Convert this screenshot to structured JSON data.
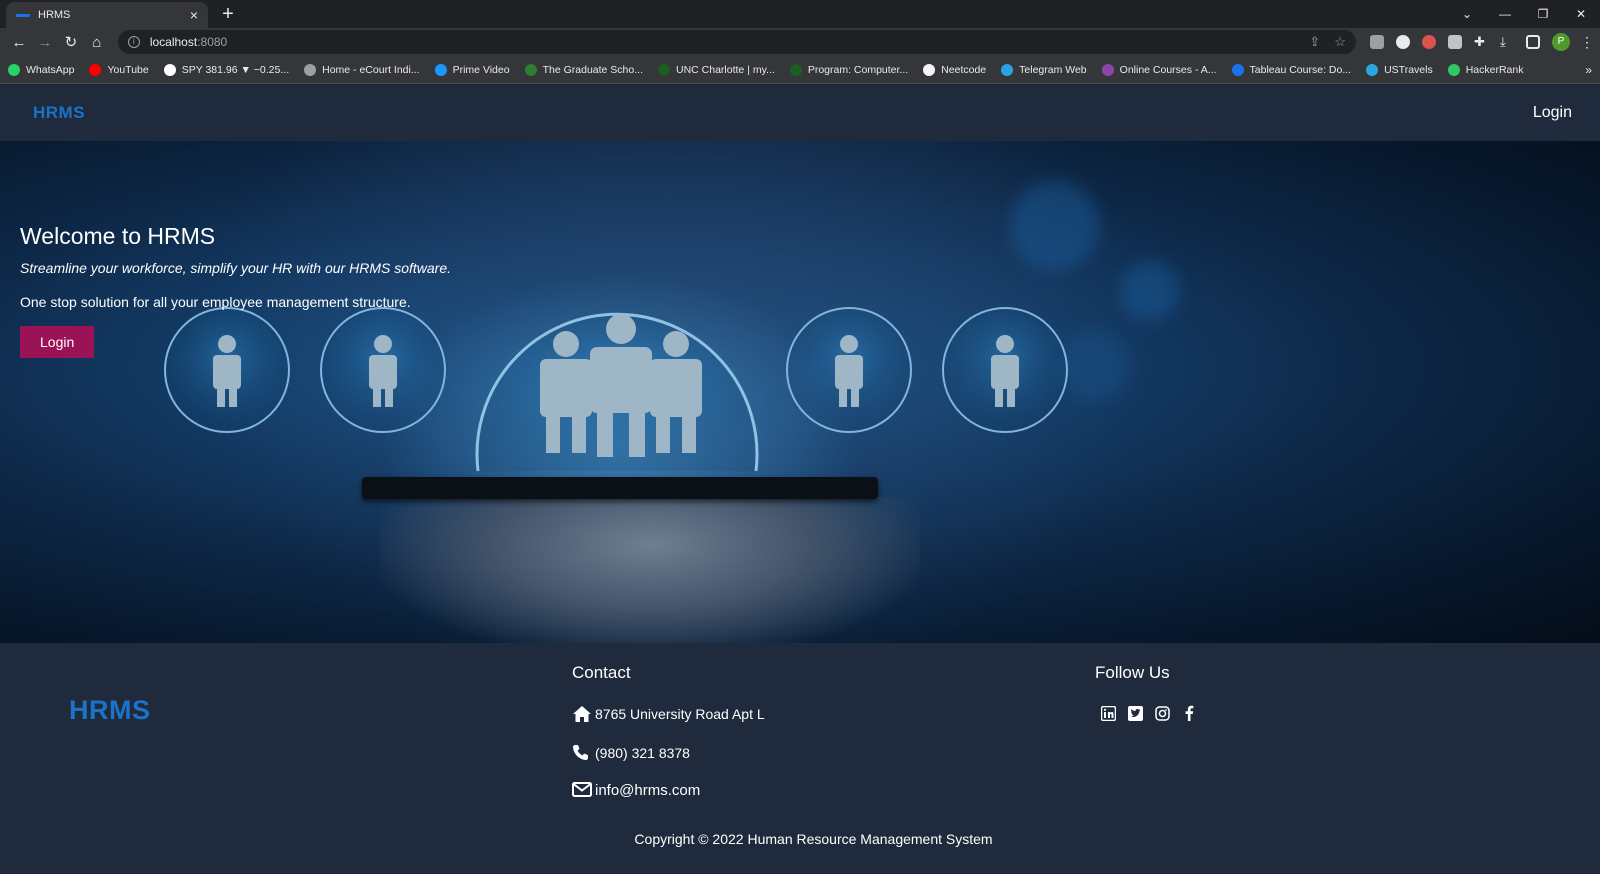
{
  "browser": {
    "tab_title": "HRMS",
    "tab_close": "×",
    "new_tab": "+",
    "url_host": "localhost",
    "url_port": ":8080",
    "bookmarks": [
      {
        "label": "WhatsApp",
        "color": "#25d366"
      },
      {
        "label": "YouTube",
        "color": "#ff0000"
      },
      {
        "label": "SPY 381.96 ▼ −0.25...",
        "color": "#ffffff"
      },
      {
        "label": "Home - eCourt Indi...",
        "color": "#9aa0a6"
      },
      {
        "label": "Prime Video",
        "color": "#1a98ff"
      },
      {
        "label": "The Graduate Scho...",
        "color": "#2e7d32"
      },
      {
        "label": "UNC Charlotte | my...",
        "color": "#1b5e20"
      },
      {
        "label": "Program: Computer...",
        "color": "#1b5e20"
      },
      {
        "label": "Neetcode",
        "color": "#f5f5f5"
      },
      {
        "label": "Telegram Web",
        "color": "#2aa3e0"
      },
      {
        "label": "Online Courses - A...",
        "color": "#8e44ad"
      },
      {
        "label": "Tableau Course: Do...",
        "color": "#1a73e8"
      },
      {
        "label": "USTravels",
        "color": "#29a8e0"
      },
      {
        "label": "HackerRank",
        "color": "#2ec866"
      }
    ],
    "bookmarks_more": "»",
    "profile_initial": "P"
  },
  "nav": {
    "brand": "HRMS",
    "login": "Login"
  },
  "hero": {
    "title": "Welcome to HRMS",
    "subtitle": "Streamline your workforce, simplify your HR with our HRMS software.",
    "description": "One stop solution for all your employee management structure.",
    "login_button": "Login"
  },
  "footer": {
    "brand": "HRMS",
    "contact_heading": "Contact",
    "address": "8765 University Road Apt L",
    "phone": "(980) 321 8378",
    "email": "info@hrms.com",
    "follow_heading": "Follow Us",
    "social": [
      "linkedin-icon",
      "twitter-icon",
      "instagram-icon",
      "facebook-icon"
    ],
    "copyright": "Copyright © 2022 Human Resource Management System"
  },
  "colors": {
    "brand_blue": "#1a73c8",
    "login_button": "#9c1256",
    "background": "#1f2a3c"
  }
}
